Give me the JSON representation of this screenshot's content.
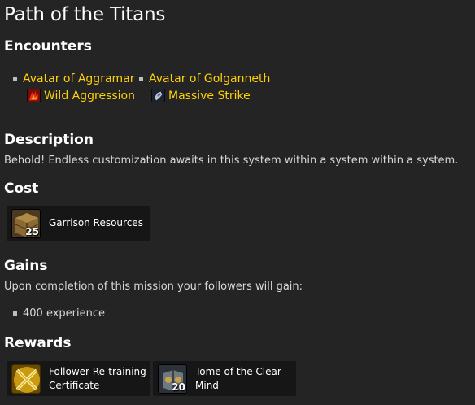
{
  "title": "Path of the Titans",
  "encounters": {
    "heading": "Encounters",
    "npcs": [
      {
        "name": "Avatar of Aggramar",
        "ability": "Wild Aggression",
        "ability_icon": "red-fire-claw-icon"
      },
      {
        "name": "Avatar of Golganneth",
        "ability": "Massive Strike",
        "ability_icon": "armored-fist-icon"
      }
    ]
  },
  "description": {
    "heading": "Description",
    "text": "Behold! Endless customization awaits in this system within a system within a system."
  },
  "cost": {
    "heading": "Cost",
    "items": [
      {
        "name": "Garrison Resources",
        "count": "25",
        "icon": "wooden-crate-icon"
      }
    ]
  },
  "gains": {
    "heading": "Gains",
    "text": "Upon completion of this mission your followers will gain:",
    "items": [
      "400 experience"
    ]
  },
  "rewards": {
    "heading": "Rewards",
    "items": [
      {
        "name_line1": "Follower Re-training",
        "name_line2": "Certificate",
        "count": "",
        "icon": "crossed-swords-icon"
      },
      {
        "name_line1": "Tome of the Clear",
        "name_line2": "Mind",
        "count": "20",
        "icon": "tome-icon"
      }
    ]
  },
  "colors": {
    "link": "#ffd100",
    "background": "#242424",
    "card": "#161616"
  }
}
